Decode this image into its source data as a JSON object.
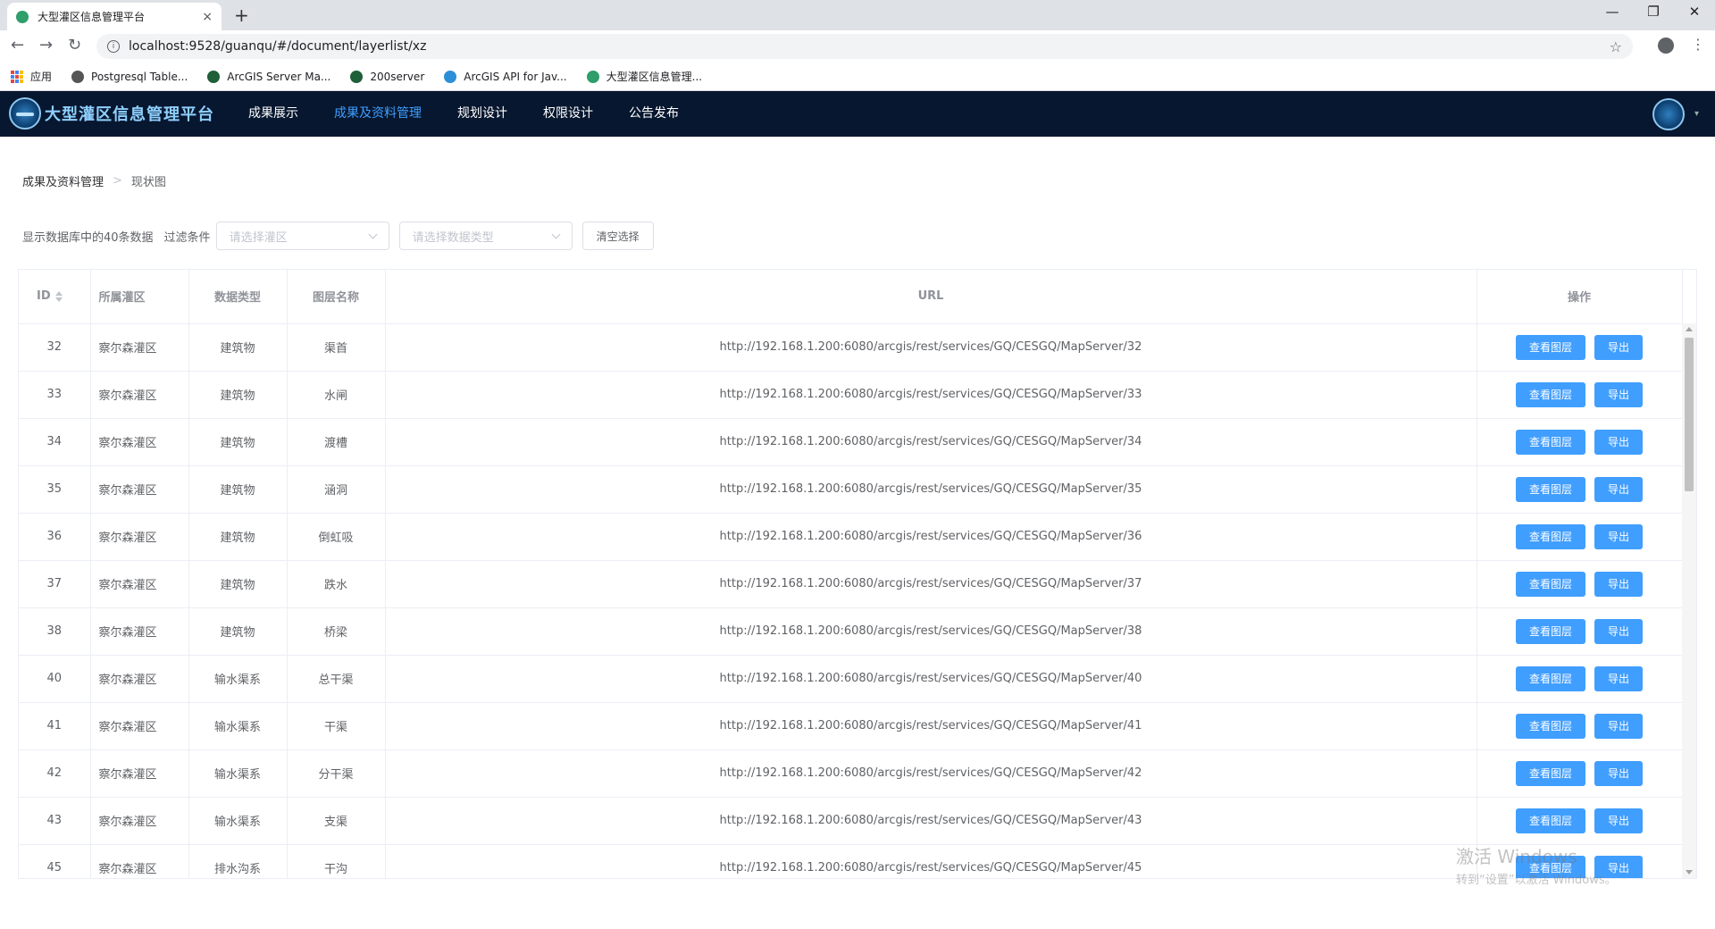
{
  "browser": {
    "tab_title": "大型灌区信息管理平台",
    "tab_close": "×",
    "new_tab": "+",
    "url": "localhost:9528/guanqu/#/document/layerlist/xz",
    "window_controls": {
      "minimize": "—",
      "maximize": "❐",
      "close": "✕"
    },
    "nav": {
      "back": "←",
      "forward": "→",
      "reload": "↻"
    },
    "star": "☆",
    "menu": "⋮",
    "bookmarks": [
      {
        "label": "应用",
        "icon": "apps-grid-icon",
        "color": ""
      },
      {
        "label": "Postgresql Table...",
        "icon": "globe-icon",
        "color": "#555555"
      },
      {
        "label": "ArcGIS Server Ma...",
        "icon": "arcgis-globe-icon",
        "color": "#1f5f3a"
      },
      {
        "label": "200server",
        "icon": "arcgis-globe-icon",
        "color": "#1f5f3a"
      },
      {
        "label": "ArcGIS API for Jav...",
        "icon": "arcgis-api-icon",
        "color": "#2b8fd6"
      },
      {
        "label": "大型灌区信息管理...",
        "icon": "vue-icon",
        "color": "#2e9e6a"
      }
    ]
  },
  "app": {
    "title": "大型灌区信息管理平台",
    "nav": [
      "成果展示",
      "成果及资料管理",
      "规划设计",
      "权限设计",
      "公告发布"
    ],
    "active_nav": "成果及资料管理",
    "user_caret": "▾"
  },
  "breadcrumb": {
    "parent": "成果及资料管理",
    "separator": ">",
    "current": "现状图"
  },
  "filter": {
    "count_text": "显示数据库中的40条数据",
    "label": "过滤条件",
    "district_placeholder": "请选择灌区",
    "type_placeholder": "请选择数据类型",
    "clear_label": "清空选择"
  },
  "table": {
    "columns": [
      "ID",
      "所属灌区",
      "数据类型",
      "图层名称",
      "URL",
      "操作"
    ],
    "view_label": "查看图层",
    "export_label": "导出",
    "rows": [
      {
        "id": "32",
        "district": "察尔森灌区",
        "type": "建筑物",
        "layer": "渠首",
        "url": "http://192.168.1.200:6080/arcgis/rest/services/GQ/CESGQ/MapServer/32"
      },
      {
        "id": "33",
        "district": "察尔森灌区",
        "type": "建筑物",
        "layer": "水闸",
        "url": "http://192.168.1.200:6080/arcgis/rest/services/GQ/CESGQ/MapServer/33"
      },
      {
        "id": "34",
        "district": "察尔森灌区",
        "type": "建筑物",
        "layer": "渡槽",
        "url": "http://192.168.1.200:6080/arcgis/rest/services/GQ/CESGQ/MapServer/34"
      },
      {
        "id": "35",
        "district": "察尔森灌区",
        "type": "建筑物",
        "layer": "涵洞",
        "url": "http://192.168.1.200:6080/arcgis/rest/services/GQ/CESGQ/MapServer/35"
      },
      {
        "id": "36",
        "district": "察尔森灌区",
        "type": "建筑物",
        "layer": "倒虹吸",
        "url": "http://192.168.1.200:6080/arcgis/rest/services/GQ/CESGQ/MapServer/36"
      },
      {
        "id": "37",
        "district": "察尔森灌区",
        "type": "建筑物",
        "layer": "跌水",
        "url": "http://192.168.1.200:6080/arcgis/rest/services/GQ/CESGQ/MapServer/37"
      },
      {
        "id": "38",
        "district": "察尔森灌区",
        "type": "建筑物",
        "layer": "桥梁",
        "url": "http://192.168.1.200:6080/arcgis/rest/services/GQ/CESGQ/MapServer/38"
      },
      {
        "id": "40",
        "district": "察尔森灌区",
        "type": "输水渠系",
        "layer": "总干渠",
        "url": "http://192.168.1.200:6080/arcgis/rest/services/GQ/CESGQ/MapServer/40"
      },
      {
        "id": "41",
        "district": "察尔森灌区",
        "type": "输水渠系",
        "layer": "干渠",
        "url": "http://192.168.1.200:6080/arcgis/rest/services/GQ/CESGQ/MapServer/41"
      },
      {
        "id": "42",
        "district": "察尔森灌区",
        "type": "输水渠系",
        "layer": "分干渠",
        "url": "http://192.168.1.200:6080/arcgis/rest/services/GQ/CESGQ/MapServer/42"
      },
      {
        "id": "43",
        "district": "察尔森灌区",
        "type": "输水渠系",
        "layer": "支渠",
        "url": "http://192.168.1.200:6080/arcgis/rest/services/GQ/CESGQ/MapServer/43"
      },
      {
        "id": "45",
        "district": "察尔森灌区",
        "type": "排水沟系",
        "layer": "干沟",
        "url": "http://192.168.1.200:6080/arcgis/rest/services/GQ/CESGQ/MapServer/45"
      }
    ]
  },
  "watermark": {
    "line1": "激活 Windows",
    "line2": "转到“设置”以激活 Windows。"
  },
  "colors": {
    "header_bg": "#07172f",
    "accent": "#409eff",
    "title": "#8fd0ff"
  }
}
